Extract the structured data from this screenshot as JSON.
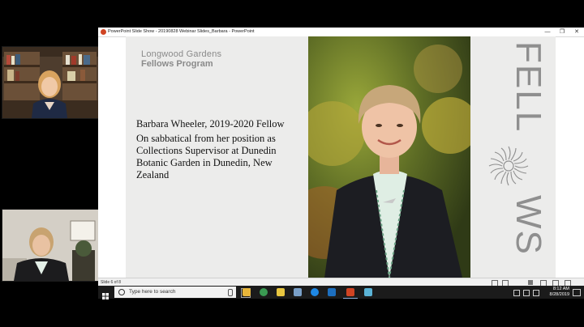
{
  "window": {
    "title": "PowerPoint Slide Show  -  20190828 Webinar Slides_Barbara  -  PowerPoint",
    "minimize_glyph": "—",
    "restore_glyph": "❐",
    "close_glyph": "✕"
  },
  "slide": {
    "brand_line1": "Longwood Gardens",
    "brand_line2": "Fellows Program",
    "name": "Barbara Wheeler, 2019-2020 Fellow",
    "description": "On sabbatical from her position as Collections Supervisor at Dunedin Botanic Garden in Dunedin, New Zealand",
    "vertical_word_top": "FELL",
    "vertical_word_bottom": "WS"
  },
  "status": {
    "slide_indicator": "Slide 6 of 8"
  },
  "taskbar": {
    "search_placeholder": "Type here to search",
    "time": "8:12 AM",
    "date": "8/28/2019"
  },
  "colors": {
    "accent": "#d04423",
    "taskbar": "#1b1b1b",
    "slide_bg": "#ececeb"
  }
}
